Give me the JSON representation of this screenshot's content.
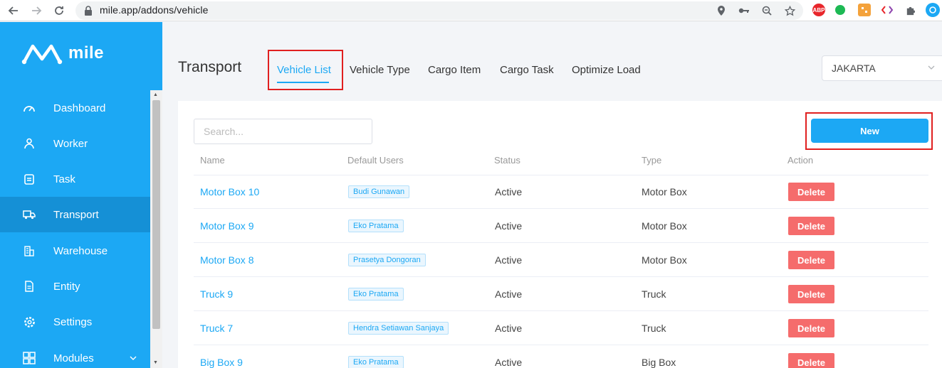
{
  "browser": {
    "url": "mile.app/addons/vehicle",
    "extensions": {
      "abp": "ABP"
    }
  },
  "sidebar": {
    "brand": "mile",
    "items": [
      {
        "label": "Dashboard",
        "icon": "speedometer-icon"
      },
      {
        "label": "Worker",
        "icon": "worker-icon"
      },
      {
        "label": "Task",
        "icon": "clipboard-icon"
      },
      {
        "label": "Transport",
        "icon": "truck-icon",
        "active": true
      },
      {
        "label": "Warehouse",
        "icon": "building-icon"
      },
      {
        "label": "Entity",
        "icon": "document-icon"
      },
      {
        "label": "Settings",
        "icon": "gear-icon"
      },
      {
        "label": "Modules",
        "icon": "modules-icon"
      }
    ]
  },
  "header": {
    "title": "Transport",
    "tabs": [
      "Vehicle List",
      "Vehicle Type",
      "Cargo Item",
      "Cargo Task",
      "Optimize Load"
    ],
    "active_tab": "Vehicle List",
    "city": "JAKARTA"
  },
  "toolbar": {
    "search_placeholder": "Search...",
    "new_label": "New"
  },
  "table": {
    "columns": [
      "Name",
      "Default Users",
      "Status",
      "Type",
      "Action"
    ],
    "rows": [
      {
        "name": "Motor Box 10",
        "user": "Budi Gunawan",
        "status": "Active",
        "type": "Motor Box",
        "action": "Delete"
      },
      {
        "name": "Motor Box 9",
        "user": "Eko Pratama",
        "status": "Active",
        "type": "Motor Box",
        "action": "Delete"
      },
      {
        "name": "Motor Box 8",
        "user": "Prasetya Dongoran",
        "status": "Active",
        "type": "Motor Box",
        "action": "Delete"
      },
      {
        "name": "Truck 9",
        "user": "Eko Pratama",
        "status": "Active",
        "type": "Truck",
        "action": "Delete"
      },
      {
        "name": "Truck 7",
        "user": "Hendra Setiawan Sanjaya",
        "status": "Active",
        "type": "Truck",
        "action": "Delete"
      },
      {
        "name": "Big Box 9",
        "user": "Eko Pratama",
        "status": "Active",
        "type": "Big Box",
        "action": "Delete"
      }
    ]
  },
  "colors": {
    "brand": "#1ca8f4",
    "sidebar_active": "#1590d6",
    "delete": "#f56c6c",
    "highlight_box": "#e02020"
  }
}
